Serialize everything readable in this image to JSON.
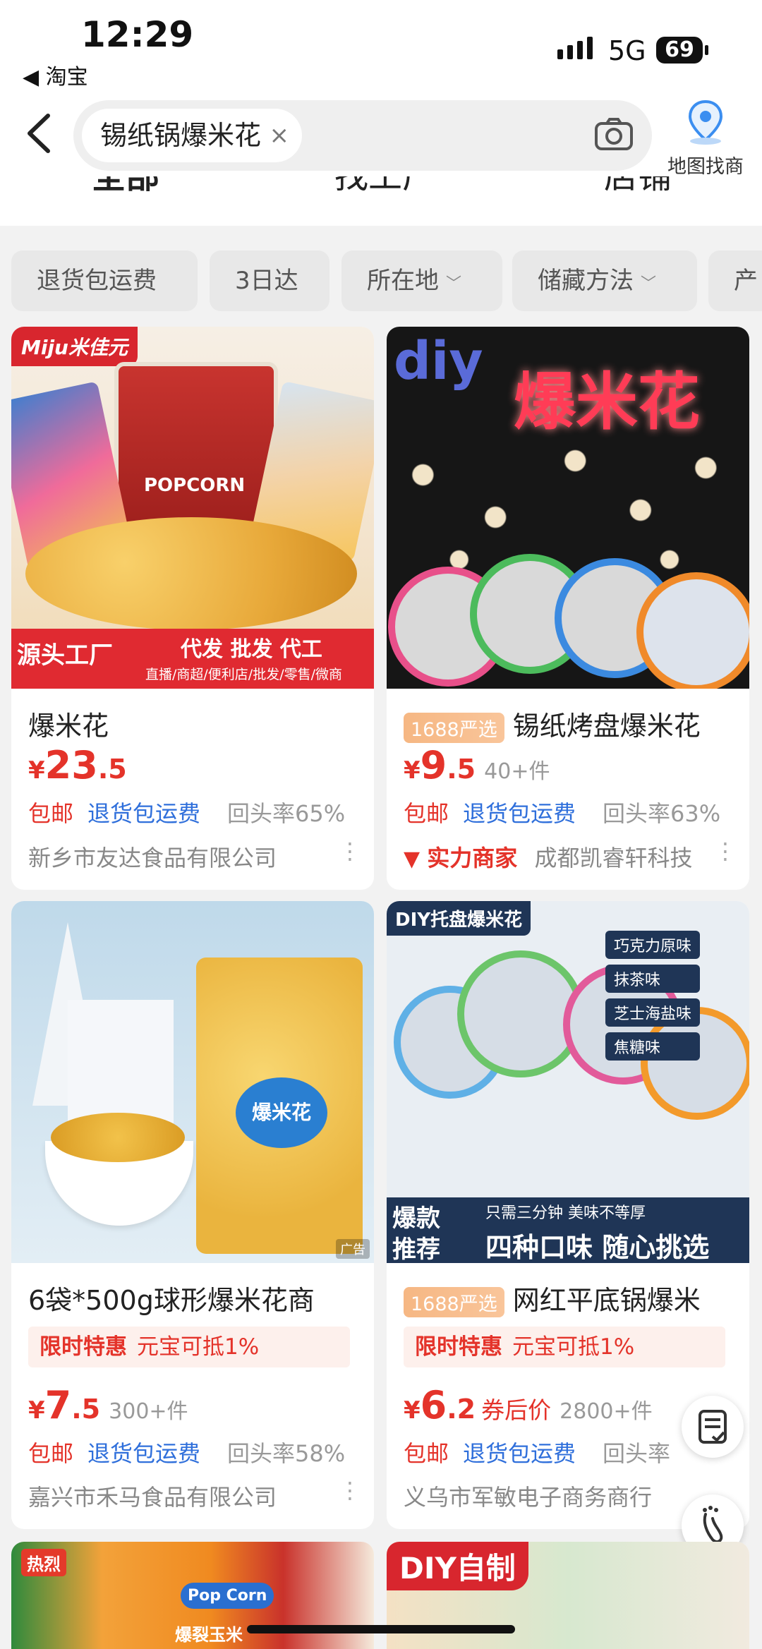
{
  "status": {
    "time": "12:29",
    "back_app": "◀ 淘宝",
    "network": "5G",
    "battery": "69"
  },
  "search": {
    "query": "锡纸锅爆米花",
    "clear": "×",
    "map_search": "地图找商"
  },
  "tabs": [
    "全部",
    "找工厂",
    "店铺"
  ],
  "filters": [
    {
      "label": "退货包运费",
      "chev": ""
    },
    {
      "label": "3日达",
      "chev": ""
    },
    {
      "label": "所在地",
      "chev": "﹀"
    },
    {
      "label": "储藏方法",
      "chev": "﹀"
    },
    {
      "label": "产",
      "chev": ""
    }
  ],
  "products": [
    {
      "img_brand": "Miju米佳元",
      "img_banner_left": "源头工厂",
      "img_banner_right": "代发 批发 代工",
      "img_banner_sub": "直播/商超/便利店/批发/零售/微商",
      "img_popcorn": "POPCORN",
      "title": "爆米花",
      "price_int": "23",
      "price_dec": ".5",
      "sold": "",
      "free_ship": "包邮",
      "return_ship": "退货包运费",
      "repurchase": "回头率65%",
      "shop": "新乡市友达食品有限公司"
    },
    {
      "img_logo": "diy",
      "img_title": "爆米花",
      "badge": "1688严选",
      "title": "锡纸烤盘爆米花",
      "price_int": "9",
      "price_dec": ".5",
      "sold": "40+件",
      "free_ship": "包邮",
      "return_ship": "退货包运费",
      "repurchase": "回头率63%",
      "merchant_badge": "实力商家",
      "shop": "成都凯睿轩科技"
    },
    {
      "ad": "广告",
      "img_bag_label": "爆米花",
      "title": "6袋*500g球形爆米花商",
      "promo_label": "限时特惠",
      "promo_text": "元宝可抵1%",
      "price_int": "7",
      "price_dec": ".5",
      "sold": "300+件",
      "free_ship": "包邮",
      "return_ship": "退货包运费",
      "repurchase": "回头率58%",
      "shop": "嘉兴市禾马食品有限公司"
    },
    {
      "img_header": "DIY托盘爆米花",
      "flavors": [
        "巧克力原味",
        "抹茶味",
        "芝士海盐味",
        "焦糖味"
      ],
      "img_hot1": "爆款",
      "img_hot2": "推荐",
      "img_small": "只需三分钟 美味不等厚",
      "img_big": "四种口味 随心挑选",
      "badge": "1688严选",
      "title": "网红平底锅爆米",
      "promo_label": "限时特惠",
      "promo_text": "元宝可抵1%",
      "price_int": "6",
      "price_dec": ".2",
      "coupon": "券后价",
      "sold": "2800+件",
      "free_ship": "包邮",
      "return_ship": "退货包运费",
      "repurchase": "回头率",
      "shop": "义乌市军敏电子商务商行"
    }
  ],
  "bottom": {
    "left_tag": "热烈",
    "left_brand": "Pop Corn",
    "left_text": "爆裂玉米",
    "right_banner": "DIY自制"
  },
  "colors": {
    "accent": "#e4332a",
    "link": "#2f6fdb",
    "badge": "#f6b783"
  }
}
